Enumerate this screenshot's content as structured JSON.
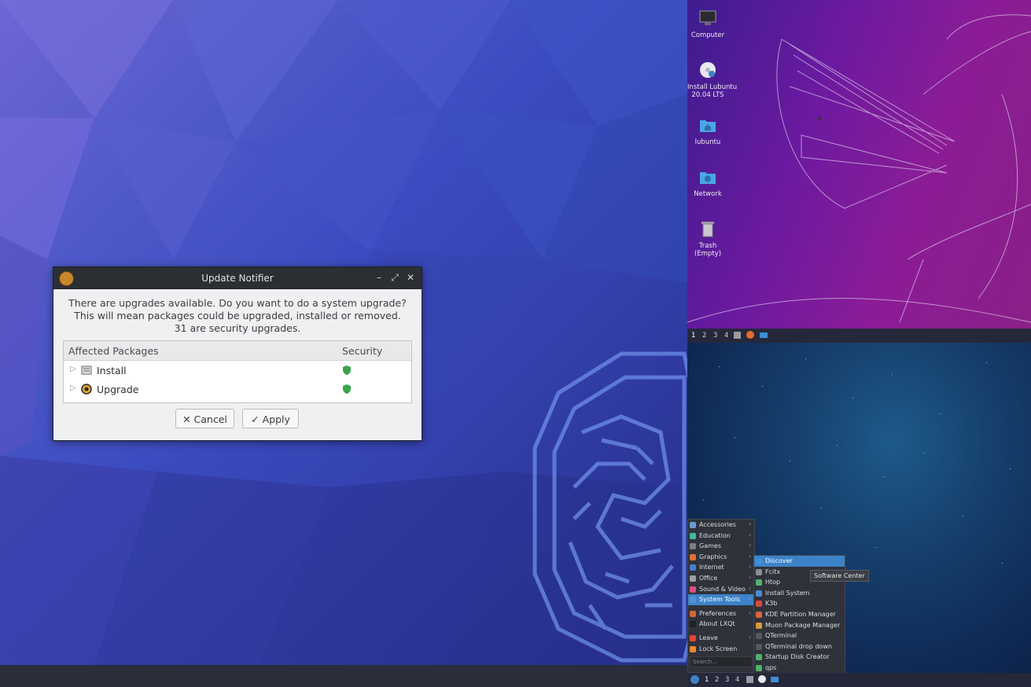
{
  "left": {
    "dialog": {
      "title": "Update Notifier",
      "message_lines": [
        "There are upgrades available. Do you want to do a system upgrade?",
        "This will mean packages could be upgraded, installed or removed.",
        "31 are security upgrades."
      ],
      "columns": [
        "Affected Packages",
        "Security"
      ],
      "rows": [
        {
          "label": "Install",
          "icon": "package-icon"
        },
        {
          "label": "Upgrade",
          "icon": "upgrade-icon"
        }
      ],
      "cancel_label": "Cancel",
      "apply_label": "Apply"
    }
  },
  "top_right": {
    "desktop_icons": [
      {
        "label": "Computer",
        "icon": "computer-icon"
      },
      {
        "label": "Install Lubuntu\n20.04 LTS",
        "icon": "install-disc-icon"
      },
      {
        "label": "lubuntu",
        "icon": "home-folder-icon"
      },
      {
        "label": "Network",
        "icon": "network-folder-icon"
      },
      {
        "label": "Trash (Empty)",
        "icon": "trash-icon"
      }
    ],
    "workspaces": [
      "1",
      "2",
      "3",
      "4"
    ]
  },
  "bottom_right": {
    "workspaces": [
      "1",
      "2",
      "3",
      "4"
    ],
    "main_menu": [
      {
        "label": "Accessories",
        "color": "#6a9bd8"
      },
      {
        "label": "Education",
        "color": "#3fb8a6"
      },
      {
        "label": "Games",
        "color": "#7a7f88"
      },
      {
        "label": "Graphics",
        "color": "#e0703a"
      },
      {
        "label": "Internet",
        "color": "#4b7bd6"
      },
      {
        "label": "Office",
        "color": "#9aa0a8"
      },
      {
        "label": "Sound & Video",
        "color": "#d94d8a"
      },
      {
        "label": "System Tools",
        "color": "#5b8fd6"
      },
      {
        "label": "Preferences",
        "color": "#d6663b"
      },
      {
        "label": "About LXQt",
        "color": "#222222"
      },
      {
        "label": "Leave",
        "color": "#e0463b"
      },
      {
        "label": "Lock Screen",
        "color": "#e88a2e"
      }
    ],
    "search_placeholder": "Search...",
    "submenu": [
      {
        "label": "Discover",
        "color": "#3d8fd6"
      },
      {
        "label": "Fcitx",
        "color": "#8a8d93"
      },
      {
        "label": "Htop",
        "color": "#4fb36a"
      },
      {
        "label": "Install System",
        "color": "#4b8bd6"
      },
      {
        "label": "K3b",
        "color": "#d84a3a"
      },
      {
        "label": "KDE Partition Manager",
        "color": "#d6663b"
      },
      {
        "label": "Muon Package Manager",
        "color": "#d89a3a"
      },
      {
        "label": "QTerminal",
        "color": "#555a60"
      },
      {
        "label": "QTerminal drop down",
        "color": "#555a60"
      },
      {
        "label": "Startup Disk Creator",
        "color": "#4fb36a"
      },
      {
        "label": "qps",
        "color": "#4fb36a"
      }
    ],
    "tooltip": "Software Center"
  }
}
